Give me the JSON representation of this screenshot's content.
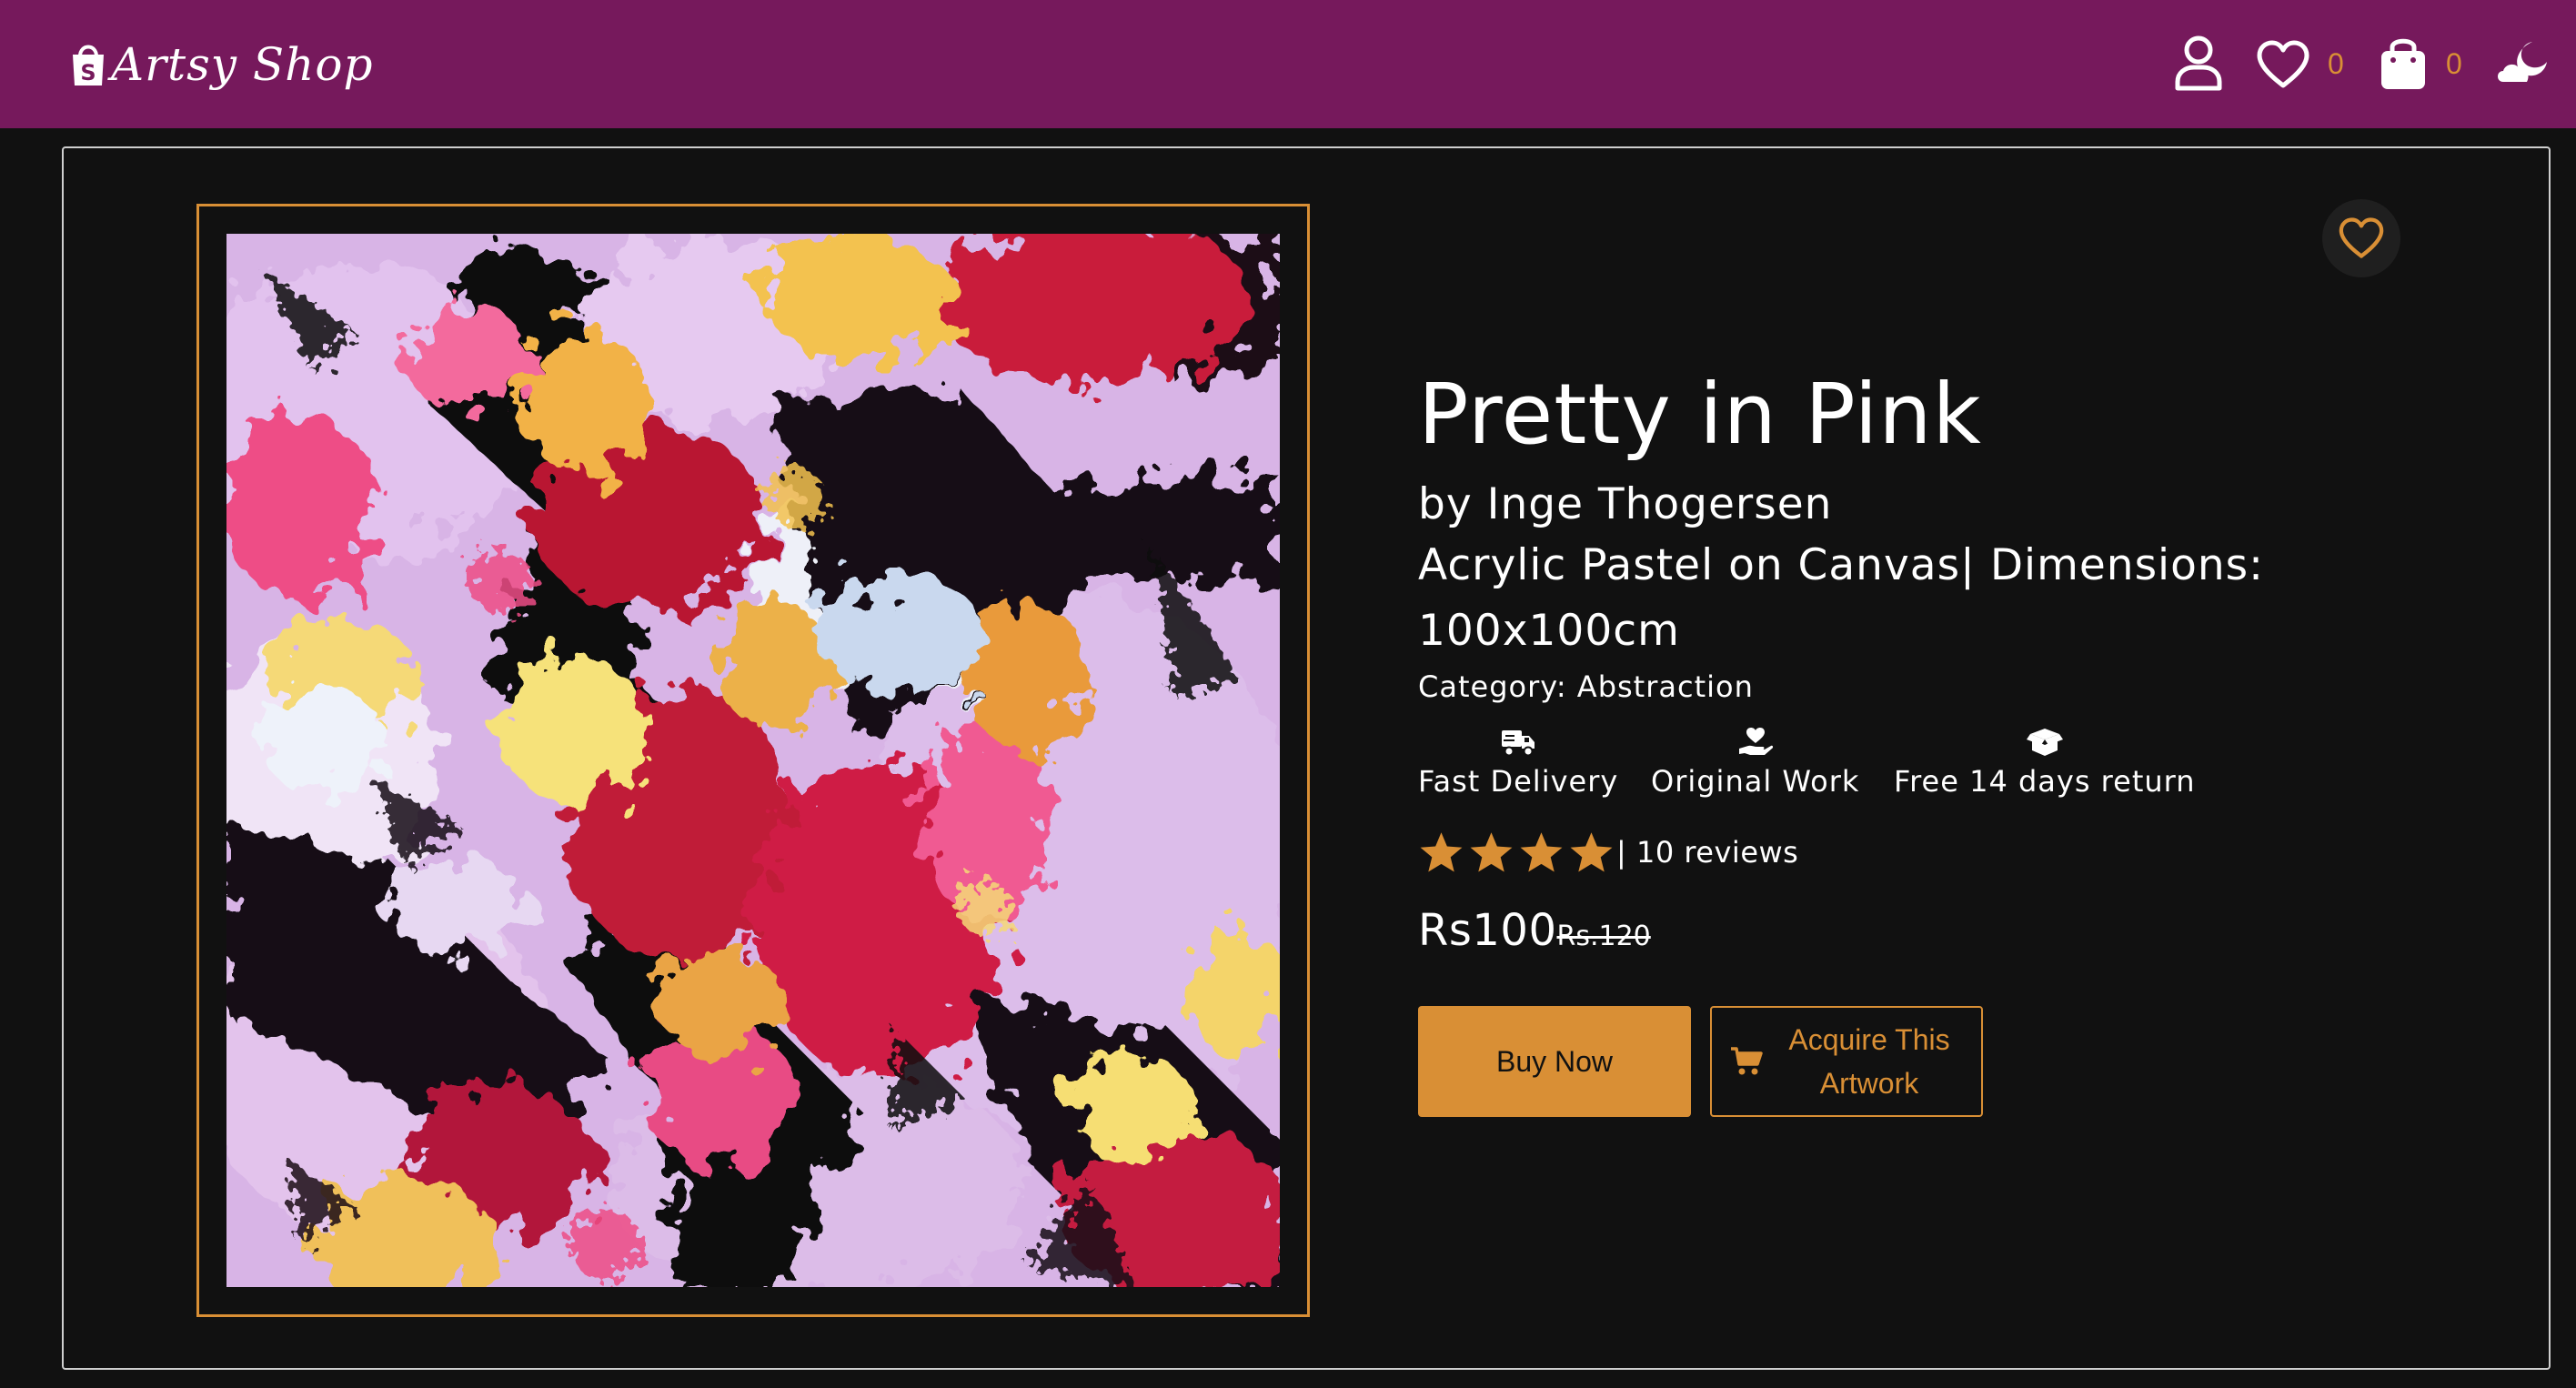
{
  "navbar": {
    "brand": {
      "name": "Artsy Shop",
      "icon": "shopping-bag-logo-icon"
    },
    "icons": {
      "account": "user-icon",
      "wishlist": "heart-outline-icon",
      "cart": "shopping-bag-icon",
      "theme": "moon-cloud-icon"
    },
    "wishlist_count": "0",
    "cart_count": "0"
  },
  "product": {
    "title": "Pretty in Pink",
    "artist": "by Inge Thogersen",
    "medium": "Acrylic Pastel on Canvas| Dimensions: 100x100cm",
    "category": "Category: Abstraction",
    "image_subject": "abstract painting in pink, red, yellow, lilac and black",
    "features": [
      {
        "icon": "delivery-truck-icon",
        "label": "Fast Delivery"
      },
      {
        "icon": "hand-heart-icon",
        "label": "Original Work"
      },
      {
        "icon": "box-icon",
        "label": "Free 14 days return"
      }
    ],
    "rating": {
      "stars": 4,
      "max": 4,
      "reviews_text": "| 10 reviews"
    },
    "price": "Rs100",
    "old_price": "Rs.120",
    "buy_label": "Buy Now",
    "acquire_label": "Acquire This Artwork",
    "wishlist_icon": "heart-outline-icon"
  },
  "colors": {
    "navbar": "#76195c",
    "accent": "#d98f35",
    "background": "#111111",
    "text": "#ffffff",
    "frame_border": "#cfcfcf"
  }
}
